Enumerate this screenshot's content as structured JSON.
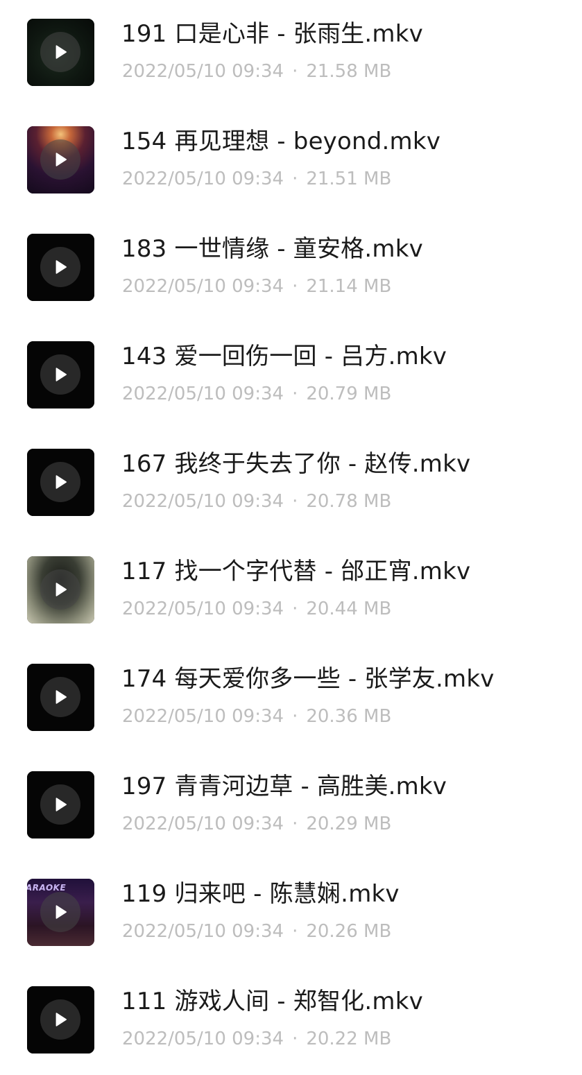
{
  "colors": {
    "title": "#1a1a1a",
    "meta": "#bdbdbd",
    "background": "#ffffff",
    "thumb_bg": "#050505"
  },
  "files": [
    {
      "name": "191 口是心非 - 张雨生.mkv",
      "date": "2022/05/10 09:34",
      "separator": "·",
      "size": "21.58 MB",
      "thumbnail": "dark-green-video-frame"
    },
    {
      "name": "154 再见理想 - beyond.mkv",
      "date": "2022/05/10 09:34",
      "separator": "·",
      "size": "21.51 MB",
      "thumbnail": "concert-crowd-frame"
    },
    {
      "name": "183 一世情缘 - 童安格.mkv",
      "date": "2022/05/10 09:34",
      "separator": "·",
      "size": "21.14 MB",
      "thumbnail": "black-frame"
    },
    {
      "name": "143 爱一回伤一回 - 吕方.mkv",
      "date": "2022/05/10 09:34",
      "separator": "·",
      "size": "20.79 MB",
      "thumbnail": "black-frame"
    },
    {
      "name": "167 我终于失去了你 - 赵传.mkv",
      "date": "2022/05/10 09:34",
      "separator": "·",
      "size": "20.78 MB",
      "thumbnail": "black-frame"
    },
    {
      "name": "117 找一个字代替 - 邰正宵.mkv",
      "date": "2022/05/10 09:34",
      "separator": "·",
      "size": "20.44 MB",
      "thumbnail": "water-sparkle-frame"
    },
    {
      "name": "174 每天爱你多一些 - 张学友.mkv",
      "date": "2022/05/10 09:34",
      "separator": "·",
      "size": "20.36 MB",
      "thumbnail": "black-frame"
    },
    {
      "name": "197 青青河边草 - 高胜美.mkv",
      "date": "2022/05/10 09:34",
      "separator": "·",
      "size": "20.29 MB",
      "thumbnail": "black-frame"
    },
    {
      "name": "119 归来吧 - 陈慧娴.mkv",
      "date": "2022/05/10 09:34",
      "separator": "·",
      "size": "20.26 MB",
      "thumbnail": "karaoke-frame",
      "thumbnail_text": "ARAOKE"
    },
    {
      "name": "111 游戏人间 - 郑智化.mkv",
      "date": "2022/05/10 09:34",
      "separator": "·",
      "size": "20.22 MB",
      "thumbnail": "black-frame"
    }
  ]
}
